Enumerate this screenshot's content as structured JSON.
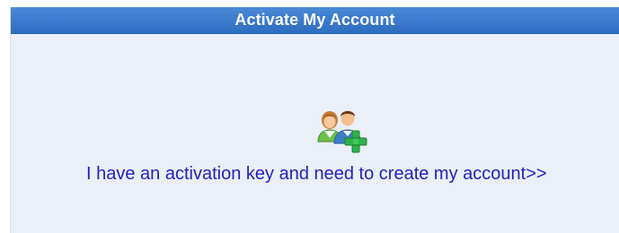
{
  "panel": {
    "title": "Activate My Account",
    "header_color": "#3a7bd0",
    "background_color": "#eaeff8"
  },
  "icon": {
    "name": "add-users-icon"
  },
  "link": {
    "label": "I have an activation key and need to create my account>>",
    "color": "#2222bb"
  }
}
